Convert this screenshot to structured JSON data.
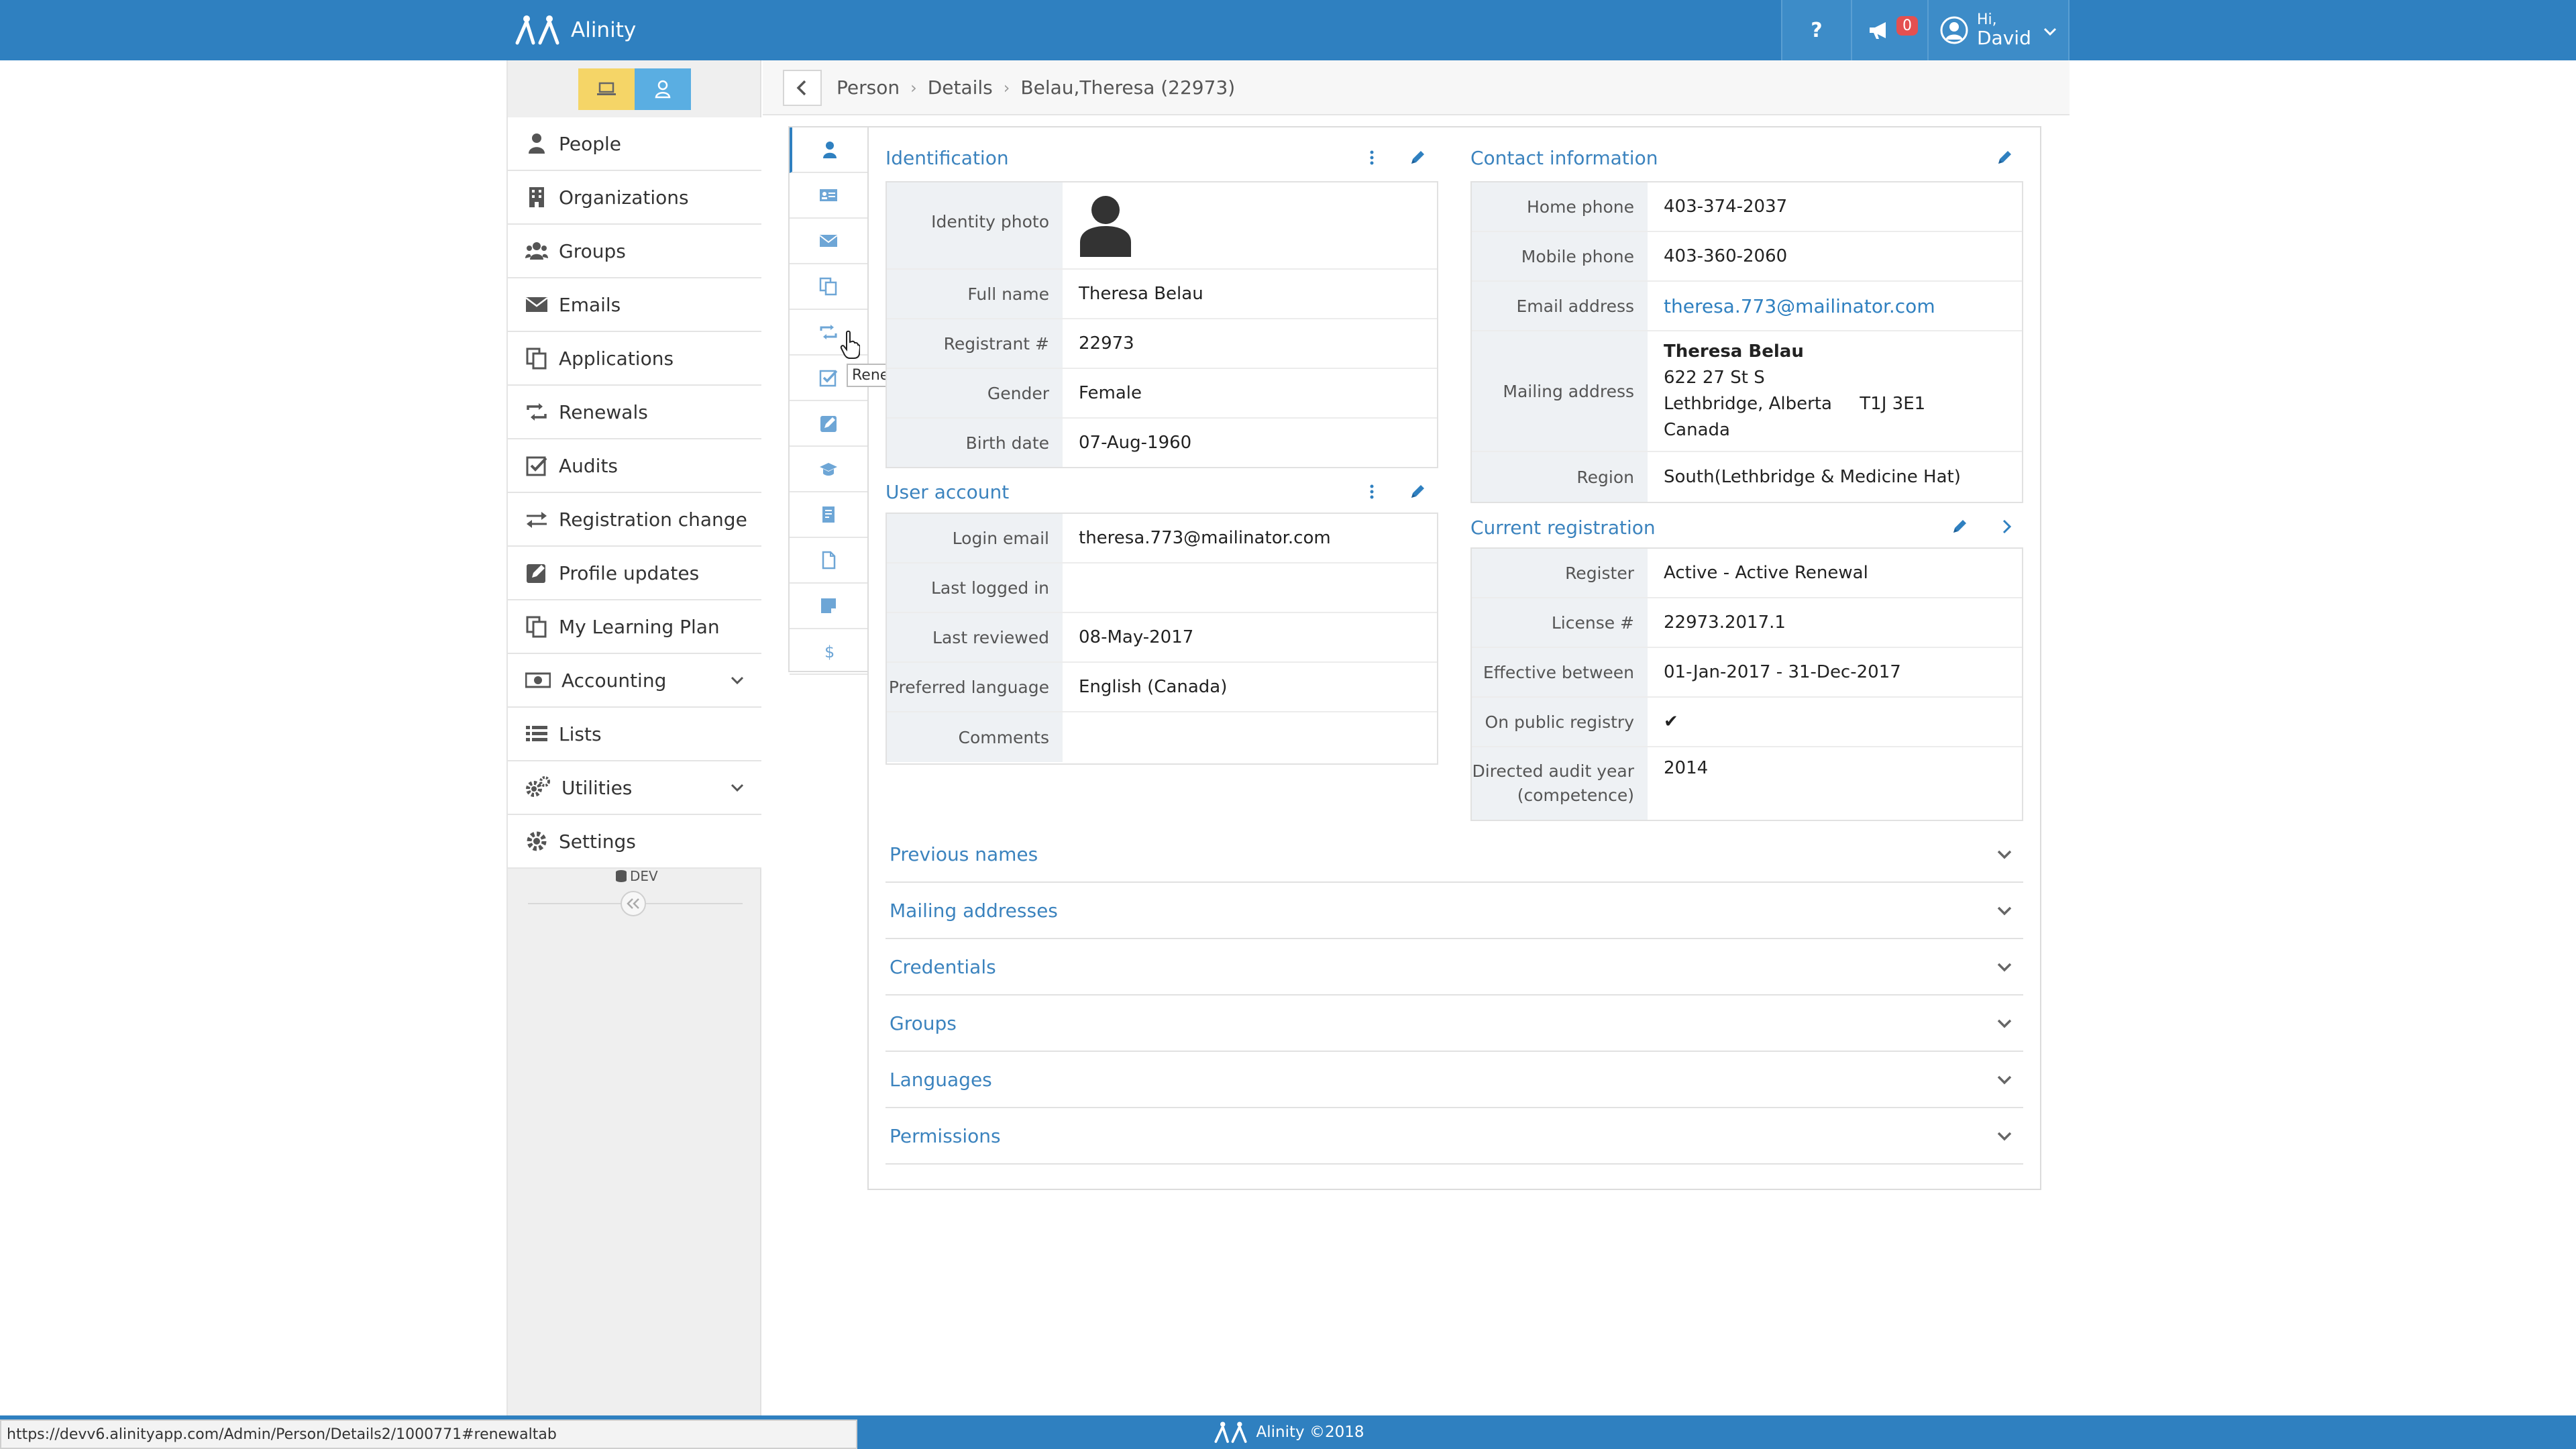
{
  "app": {
    "title": "Alinity",
    "help_label": "?",
    "notifications_count": "0",
    "user_greeting": "Hi,",
    "user_name": "David"
  },
  "sidebar": {
    "items": [
      {
        "label": "People",
        "icon": "person-icon"
      },
      {
        "label": "Organizations",
        "icon": "building-icon"
      },
      {
        "label": "Groups",
        "icon": "users-icon"
      },
      {
        "label": "Emails",
        "icon": "envelope-icon"
      },
      {
        "label": "Applications",
        "icon": "copy-icon"
      },
      {
        "label": "Renewals",
        "icon": "retweet-icon"
      },
      {
        "label": "Audits",
        "icon": "check-square-icon"
      },
      {
        "label": "Registration change",
        "icon": "exchange-icon"
      },
      {
        "label": "Profile updates",
        "icon": "edit-icon"
      },
      {
        "label": "My Learning Plan",
        "icon": "copy-icon"
      },
      {
        "label": "Accounting",
        "icon": "money-icon"
      },
      {
        "label": "Lists",
        "icon": "list-icon"
      },
      {
        "label": "Utilities",
        "icon": "cogs-icon"
      },
      {
        "label": "Settings",
        "icon": "gear-icon"
      }
    ],
    "env_tag": "DEV"
  },
  "breadcrumb": {
    "items": [
      "Person",
      "Details",
      "Belau,Theresa (22973)"
    ]
  },
  "tooltip": "Renewals",
  "identification": {
    "title": "Identification",
    "photo_label": "Identity photo",
    "rows": [
      {
        "label": "Full name",
        "value": "Theresa Belau"
      },
      {
        "label": "Registrant #",
        "value": "22973"
      },
      {
        "label": "Gender",
        "value": "Female"
      },
      {
        "label": "Birth date",
        "value": "07-Aug-1960"
      }
    ]
  },
  "user_account": {
    "title": "User account",
    "rows": [
      {
        "label": "Login email",
        "value": "theresa.773@mailinator.com"
      },
      {
        "label": "Last logged in",
        "value": ""
      },
      {
        "label": "Last reviewed",
        "value": "08-May-2017"
      },
      {
        "label": "Preferred language",
        "value": "English (Canada)"
      },
      {
        "label": "Comments",
        "value": ""
      }
    ]
  },
  "contact": {
    "title": "Contact information",
    "home_phone_label": "Home phone",
    "home_phone": "403-374-2037",
    "mobile_phone_label": "Mobile phone",
    "mobile_phone": "403-360-2060",
    "email_label": "Email address",
    "email": "theresa.773@mailinator.com",
    "mailing_label": "Mailing address",
    "mailing": {
      "name": "Theresa Belau",
      "line1": "622 27 St S",
      "line2": "Lethbridge, Alberta     T1J 3E1",
      "line3": "Canada"
    },
    "region_label": "Region",
    "region": "South(Lethbridge & Medicine Hat)"
  },
  "registration": {
    "title": "Current registration",
    "rows": [
      {
        "label": "Register",
        "value": "Active - Active Renewal"
      },
      {
        "label": "License #",
        "value": "22973.2017.1"
      },
      {
        "label": "Effective between",
        "value": "01-Jan-2017 - 31-Dec-2017"
      },
      {
        "label": "On public registry",
        "value": "✔"
      }
    ],
    "audit_label_1": "Directed audit year",
    "audit_label_2": "(competence)",
    "audit_value": "2014"
  },
  "accordions": [
    "Previous names",
    "Mailing addresses",
    "Credentials",
    "Groups",
    "Languages",
    "Permissions"
  ],
  "footer": {
    "text": "Alinity ©2018",
    "status_url": "https://devv6.alinityapp.com/Admin/Person/Details2/1000771#renewaltab"
  },
  "colors": {
    "brand": "#2f80c0",
    "section_title": "#3b83be",
    "mode_yellow": "#f5d567",
    "mode_blue": "#5aaee2"
  }
}
